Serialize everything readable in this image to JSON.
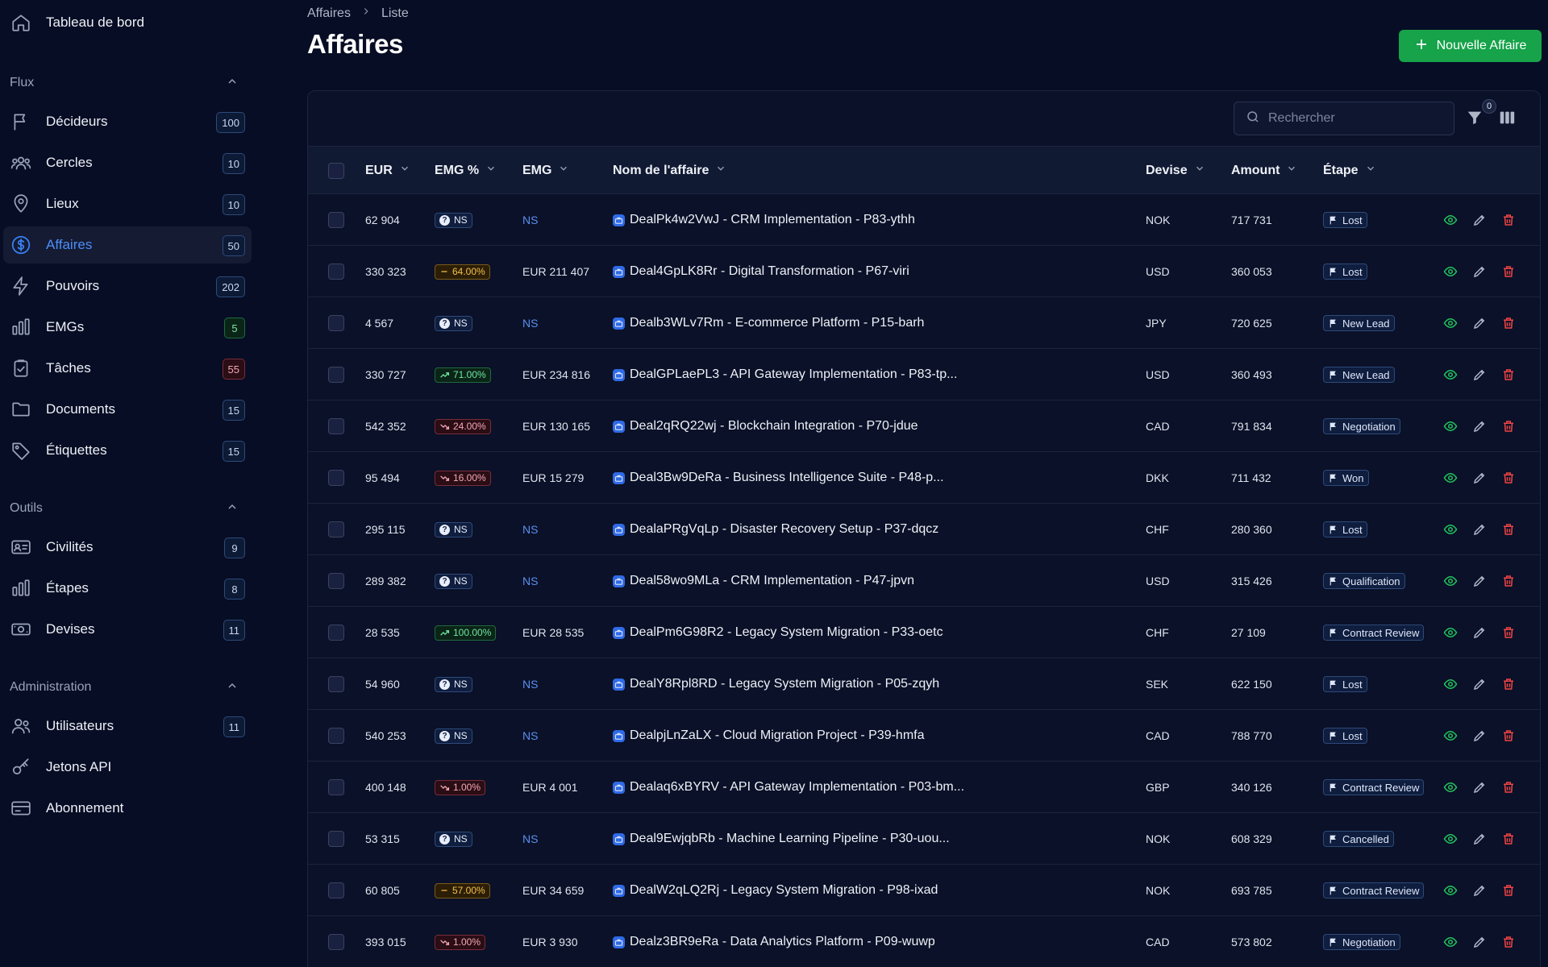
{
  "sidebar": {
    "top": {
      "label": "Tableau de bord",
      "icon": "home-icon"
    },
    "sections": [
      {
        "title": "Flux",
        "items": [
          {
            "label": "Décideurs",
            "count": "100",
            "icon": "flag-icon",
            "tone": "blue"
          },
          {
            "label": "Cercles",
            "count": "10",
            "icon": "users-group-icon",
            "tone": "blue"
          },
          {
            "label": "Lieux",
            "count": "10",
            "icon": "map-pin-icon",
            "tone": "blue"
          },
          {
            "label": "Affaires",
            "count": "50",
            "icon": "dollar-circle-icon",
            "tone": "blue",
            "active": true
          },
          {
            "label": "Pouvoirs",
            "count": "202",
            "icon": "bolt-icon",
            "tone": "blue"
          },
          {
            "label": "EMGs",
            "count": "5",
            "icon": "bar-chart-icon",
            "tone": "green"
          },
          {
            "label": "Tâches",
            "count": "55",
            "icon": "clipboard-check-icon",
            "tone": "red"
          },
          {
            "label": "Documents",
            "count": "15",
            "icon": "folder-icon",
            "tone": "blue"
          },
          {
            "label": "Étiquettes",
            "count": "15",
            "icon": "tag-icon",
            "tone": "blue"
          }
        ]
      },
      {
        "title": "Outils",
        "items": [
          {
            "label": "Civilités",
            "count": "9",
            "icon": "id-card-icon",
            "tone": "blue"
          },
          {
            "label": "Étapes",
            "count": "8",
            "icon": "bar-chart-icon",
            "tone": "blue"
          },
          {
            "label": "Devises",
            "count": "11",
            "icon": "banknote-icon",
            "tone": "blue"
          }
        ]
      },
      {
        "title": "Administration",
        "items": [
          {
            "label": "Utilisateurs",
            "count": "11",
            "icon": "users-icon",
            "tone": "blue"
          },
          {
            "label": "Jetons API",
            "count": "",
            "icon": "key-icon",
            "tone": "blue"
          },
          {
            "label": "Abonnement",
            "count": "",
            "icon": "credit-card-icon",
            "tone": "blue"
          }
        ]
      }
    ]
  },
  "breadcrumb": {
    "root": "Affaires",
    "current": "Liste"
  },
  "page": {
    "title": "Affaires",
    "new_button": "Nouvelle Affaire"
  },
  "toolbar": {
    "search_placeholder": "Rechercher",
    "filter_count": "0"
  },
  "table": {
    "columns": {
      "eur": "EUR",
      "emg_pct": "EMG %",
      "emg": "EMG",
      "name": "Nom de l'affaire",
      "devise": "Devise",
      "amount": "Amount",
      "etape": "Étape"
    },
    "rows": [
      {
        "eur": "62 904",
        "emg_pct": "NS",
        "pct_tone": "ns",
        "emg": "NS",
        "name": "DealPk4w2VwJ - CRM Implementation - P83-ythh",
        "devise": "NOK",
        "amount": "717 731",
        "stage": "Lost"
      },
      {
        "eur": "330 323",
        "emg_pct": "64.00%",
        "pct_tone": "yellow",
        "emg": "EUR 211 407",
        "name": "Deal4GpLK8Rr - Digital Transformation - P67-viri",
        "devise": "USD",
        "amount": "360 053",
        "stage": "Lost"
      },
      {
        "eur": "4 567",
        "emg_pct": "NS",
        "pct_tone": "ns",
        "emg": "NS",
        "name": "Dealb3WLv7Rm - E-commerce Platform - P15-barh",
        "devise": "JPY",
        "amount": "720 625",
        "stage": "New Lead"
      },
      {
        "eur": "330 727",
        "emg_pct": "71.00%",
        "pct_tone": "green",
        "emg": "EUR 234 816",
        "name": "DealGPLaePL3 - API Gateway Implementation - P83-tp...",
        "devise": "USD",
        "amount": "360 493",
        "stage": "New Lead"
      },
      {
        "eur": "542 352",
        "emg_pct": "24.00%",
        "pct_tone": "red",
        "emg": "EUR 130 165",
        "name": "Deal2qRQ22wj - Blockchain Integration - P70-jdue",
        "devise": "CAD",
        "amount": "791 834",
        "stage": "Negotiation"
      },
      {
        "eur": "95 494",
        "emg_pct": "16.00%",
        "pct_tone": "red",
        "emg": "EUR 15 279",
        "name": "Deal3Bw9DeRa - Business Intelligence Suite - P48-p...",
        "devise": "DKK",
        "amount": "711 432",
        "stage": "Won"
      },
      {
        "eur": "295 115",
        "emg_pct": "NS",
        "pct_tone": "ns",
        "emg": "NS",
        "name": "DealaPRgVqLp - Disaster Recovery Setup - P37-dqcz",
        "devise": "CHF",
        "amount": "280 360",
        "stage": "Lost"
      },
      {
        "eur": "289 382",
        "emg_pct": "NS",
        "pct_tone": "ns",
        "emg": "NS",
        "name": "Deal58wo9MLa - CRM Implementation - P47-jpvn",
        "devise": "USD",
        "amount": "315 426",
        "stage": "Qualification"
      },
      {
        "eur": "28 535",
        "emg_pct": "100.00%",
        "pct_tone": "green",
        "emg": "EUR 28 535",
        "name": "DealPm6G98R2 - Legacy System Migration - P33-oetc",
        "devise": "CHF",
        "amount": "27 109",
        "stage": "Contract Review"
      },
      {
        "eur": "54 960",
        "emg_pct": "NS",
        "pct_tone": "ns",
        "emg": "NS",
        "name": "DealY8Rpl8RD - Legacy System Migration - P05-zqyh",
        "devise": "SEK",
        "amount": "622 150",
        "stage": "Lost"
      },
      {
        "eur": "540 253",
        "emg_pct": "NS",
        "pct_tone": "ns",
        "emg": "NS",
        "name": "DealpjLnZaLX - Cloud Migration Project - P39-hmfa",
        "devise": "CAD",
        "amount": "788 770",
        "stage": "Lost"
      },
      {
        "eur": "400 148",
        "emg_pct": "1.00%",
        "pct_tone": "red",
        "emg": "EUR 4 001",
        "name": "Dealaq6xBYRV - API Gateway Implementation - P03-bm...",
        "devise": "GBP",
        "amount": "340 126",
        "stage": "Contract Review"
      },
      {
        "eur": "53 315",
        "emg_pct": "NS",
        "pct_tone": "ns",
        "emg": "NS",
        "name": "Deal9EwjqbRb - Machine Learning Pipeline - P30-uou...",
        "devise": "NOK",
        "amount": "608 329",
        "stage": "Cancelled"
      },
      {
        "eur": "60 805",
        "emg_pct": "57.00%",
        "pct_tone": "yellow",
        "emg": "EUR 34 659",
        "name": "DealW2qLQ2Rj - Legacy System Migration - P98-ixad",
        "devise": "NOK",
        "amount": "693 785",
        "stage": "Contract Review"
      },
      {
        "eur": "393 015",
        "emg_pct": "1.00%",
        "pct_tone": "red",
        "emg": "EUR 3 930",
        "name": "Dealz3BR9eRa - Data Analytics Platform - P09-wuwp",
        "devise": "CAD",
        "amount": "573 802",
        "stage": "Negotiation"
      }
    ]
  },
  "colors": {
    "accent": "#3b82f6",
    "primary_button": "#16a34a",
    "background": "#070d24"
  }
}
